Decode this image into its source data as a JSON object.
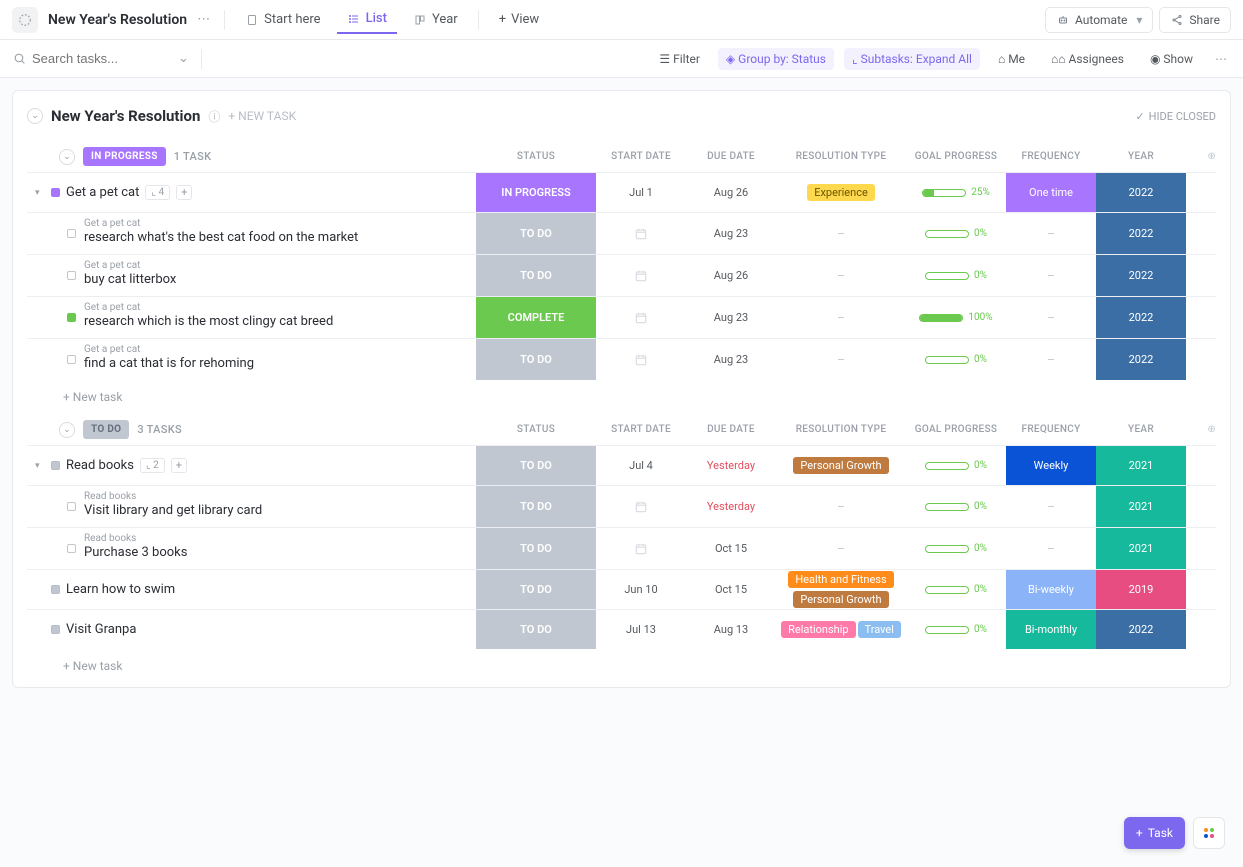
{
  "topbar": {
    "title": "New Year's Resolution",
    "nav": {
      "start_here": "Start here",
      "list": "List",
      "year": "Year",
      "view": "View"
    },
    "automate": "Automate",
    "share": "Share"
  },
  "filterbar": {
    "search_placeholder": "Search tasks...",
    "filter": "Filter",
    "group_by": "Group by: Status",
    "subtasks": "Subtasks: Expand All",
    "me": "Me",
    "assignees": "Assignees",
    "show": "Show"
  },
  "panel": {
    "title": "New Year's Resolution",
    "new_task": "+ NEW TASK",
    "hide_closed": "HIDE CLOSED"
  },
  "columns": {
    "status": "STATUS",
    "start_date": "START DATE",
    "due_date": "DUE DATE",
    "resolution_type": "RESOLUTION TYPE",
    "goal_progress": "GOAL PROGRESS",
    "frequency": "FREQUENCY",
    "year": "YEAR"
  },
  "groups": [
    {
      "id": "in_progress",
      "label": "IN PROGRESS",
      "pill_class": "in-progress",
      "count": "1 TASK",
      "tasks": [
        {
          "name": "Get a pet cat",
          "square_class": "sq-purple",
          "sub_count": "4",
          "status": "IN PROGRESS",
          "status_class": "in-progress",
          "start_date": "Jul 1",
          "due_date": "Aug 26",
          "due_class": "",
          "tags": [
            {
              "text": "Experience",
              "cls": "experience"
            }
          ],
          "progress": 25,
          "frequency": "One time",
          "freq_class": "freq-onetime",
          "year": "2022",
          "year_class": "year-2022",
          "subtasks": [
            {
              "parent": "Get a pet cat",
              "name": "research what's the best cat food on the market",
              "status": "TO DO",
              "status_class": "todo",
              "due_date": "Aug 23",
              "progress": 0,
              "year": "2022",
              "year_class": "year-2022",
              "sq": ""
            },
            {
              "parent": "Get a pet cat",
              "name": "buy cat litterbox",
              "status": "TO DO",
              "status_class": "todo",
              "due_date": "Aug 26",
              "progress": 0,
              "year": "2022",
              "year_class": "year-2022",
              "sq": ""
            },
            {
              "parent": "Get a pet cat",
              "name": "research which is the most clingy cat breed",
              "status": "COMPLETE",
              "status_class": "complete",
              "due_date": "Aug 23",
              "progress": 100,
              "year": "2022",
              "year_class": "year-2022",
              "sq": "green"
            },
            {
              "parent": "Get a pet cat",
              "name": "find a cat that is for rehoming",
              "status": "TO DO",
              "status_class": "todo",
              "due_date": "Aug 23",
              "progress": 0,
              "year": "2022",
              "year_class": "year-2022",
              "sq": ""
            }
          ]
        }
      ],
      "new_task": "+ New task"
    },
    {
      "id": "todo",
      "label": "TO DO",
      "pill_class": "todo",
      "count": "3 TASKS",
      "tasks": [
        {
          "name": "Read books",
          "square_class": "sq-grey",
          "sub_count": "2",
          "status": "TO DO",
          "status_class": "todo",
          "start_date": "Jul 4",
          "due_date": "Yesterday",
          "due_class": "red",
          "tags": [
            {
              "text": "Personal Growth",
              "cls": "personal-growth"
            }
          ],
          "progress": 0,
          "frequency": "Weekly",
          "freq_class": "freq-weekly",
          "year": "2021",
          "year_class": "year-2021",
          "subtasks": [
            {
              "parent": "Read books",
              "name": "Visit library and get library card",
              "status": "TO DO",
              "status_class": "todo",
              "due_date": "Yesterday",
              "due_class": "red",
              "progress": 0,
              "year": "2021",
              "year_class": "year-2021",
              "sq": ""
            },
            {
              "parent": "Read books",
              "name": "Purchase 3 books",
              "status": "TO DO",
              "status_class": "todo",
              "due_date": "Oct 15",
              "progress": 0,
              "year": "2021",
              "year_class": "year-2021",
              "sq": ""
            }
          ]
        },
        {
          "name": "Learn how to swim",
          "square_class": "sq-grey",
          "status": "TO DO",
          "status_class": "todo",
          "start_date": "Jun 10",
          "due_date": "Oct 15",
          "due_class": "",
          "tags": [
            {
              "text": "Health and Fitness",
              "cls": "health"
            },
            {
              "text": "Personal Growth",
              "cls": "personal-growth"
            }
          ],
          "progress": 0,
          "frequency": "Bi-weekly",
          "freq_class": "freq-biweekly",
          "year": "2019",
          "year_class": "year-2019",
          "subtasks": []
        },
        {
          "name": "Visit Granpa",
          "square_class": "sq-grey",
          "status": "TO DO",
          "status_class": "todo",
          "start_date": "Jul 13",
          "due_date": "Aug 13",
          "due_class": "",
          "tags": [
            {
              "text": "Relationship",
              "cls": "relationship"
            },
            {
              "text": "Travel",
              "cls": "travel"
            }
          ],
          "progress": 0,
          "frequency": "Bi-monthly",
          "freq_class": "freq-bimonthly",
          "year": "2022",
          "year_class": "year-2022",
          "subtasks": []
        }
      ],
      "new_task": "+ New task"
    }
  ],
  "fab": {
    "task": "Task"
  }
}
